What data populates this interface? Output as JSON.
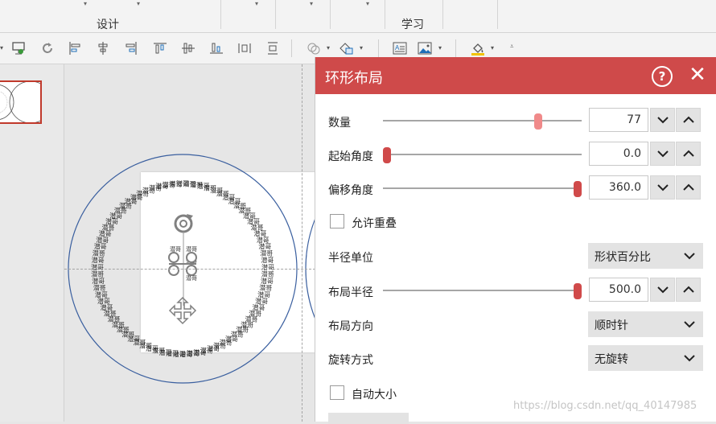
{
  "ribbon": {
    "groups": [
      {
        "label": "设计"
      },
      {
        "label": "学习"
      }
    ]
  },
  "toolbar": {
    "icons": [
      "slideshow-icon",
      "refresh-icon",
      "align-left-icon",
      "align-center-h-icon",
      "align-right-icon",
      "align-top-icon",
      "align-middle-icon",
      "align-bottom-icon",
      "distribute-h-icon",
      "distribute-v-icon",
      "merge-shapes-icon",
      "shape-style-icon",
      "text-box-icon",
      "picture-icon",
      "fill-bucket-icon"
    ]
  },
  "canvas": {
    "ring_text": "潜哥",
    "ring_count": 77
  },
  "panel": {
    "title": "环形布局",
    "help_symbol": "?",
    "close_symbol": "✕",
    "rows": {
      "count": {
        "label": "数量",
        "value": "77",
        "fraction": 0.78
      },
      "start_angle": {
        "label": "起始角度",
        "value": "0.0",
        "fraction": 0.02
      },
      "offset_angle": {
        "label": "偏移角度",
        "value": "360.0",
        "fraction": 0.98
      },
      "allow_overlap": {
        "label": "允许重叠",
        "checked": false
      },
      "radius_unit": {
        "label": "半径单位",
        "value": "形状百分比"
      },
      "layout_radius": {
        "label": "布局半径",
        "value": "500.0",
        "fraction": 0.98
      },
      "layout_direction": {
        "label": "布局方向",
        "value": "顺时针"
      },
      "rotation_mode": {
        "label": "旋转方式",
        "value": "无旋转"
      },
      "auto_size": {
        "label": "自动大小",
        "checked": false
      }
    }
  },
  "watermark": "https://blog.csdn.net/qq_40147985",
  "colors": {
    "accent": "#cf4a4a",
    "slider_thumb": "#d04a4a",
    "circle_stroke": "#3a5f9f"
  }
}
